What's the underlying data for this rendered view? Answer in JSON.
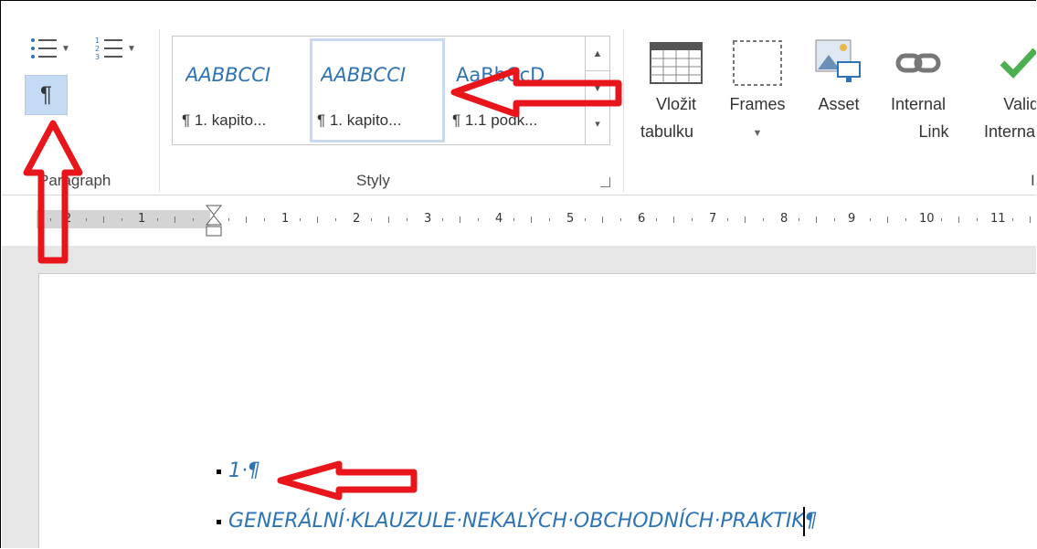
{
  "paragraph_group": {
    "label": "Paragraph",
    "show_marks_symbol": "¶"
  },
  "styles_group": {
    "label": "Styly",
    "tiles": [
      {
        "sample": "AABBCCI",
        "name": "¶ 1. kapito..."
      },
      {
        "sample": "AABBCCI",
        "name": "¶ 1. kapito..."
      },
      {
        "sample": "AaBbCcD",
        "name": "¶ 1.1 podk..."
      }
    ]
  },
  "commands": {
    "table": {
      "line1": "Vložit",
      "line2": "tabulku"
    },
    "frames": {
      "line1": "Frames"
    },
    "asset": {
      "line1": "Asset"
    },
    "internal_link": {
      "line1": "Internal",
      "line2": "Link"
    },
    "validate": {
      "line1": "Valid",
      "line2": "Internal"
    },
    "group_label_partial": "I"
  },
  "ruler": {
    "labels": [
      "2",
      "1",
      "1",
      "2",
      "3",
      "4",
      "5",
      "6",
      "7",
      "8",
      "9",
      "10",
      "11"
    ]
  },
  "document": {
    "line1": "1·¶",
    "line2": "GENERÁLNÍ·KLAUZULE·NEKALÝCH·OBCHODNÍCH·PRAKTIK",
    "line2_mark": "¶"
  },
  "colors": {
    "accent": "#2e74b5",
    "selected": "#c5daf3",
    "annotation": "#e8151b",
    "check": "#4caf50"
  }
}
